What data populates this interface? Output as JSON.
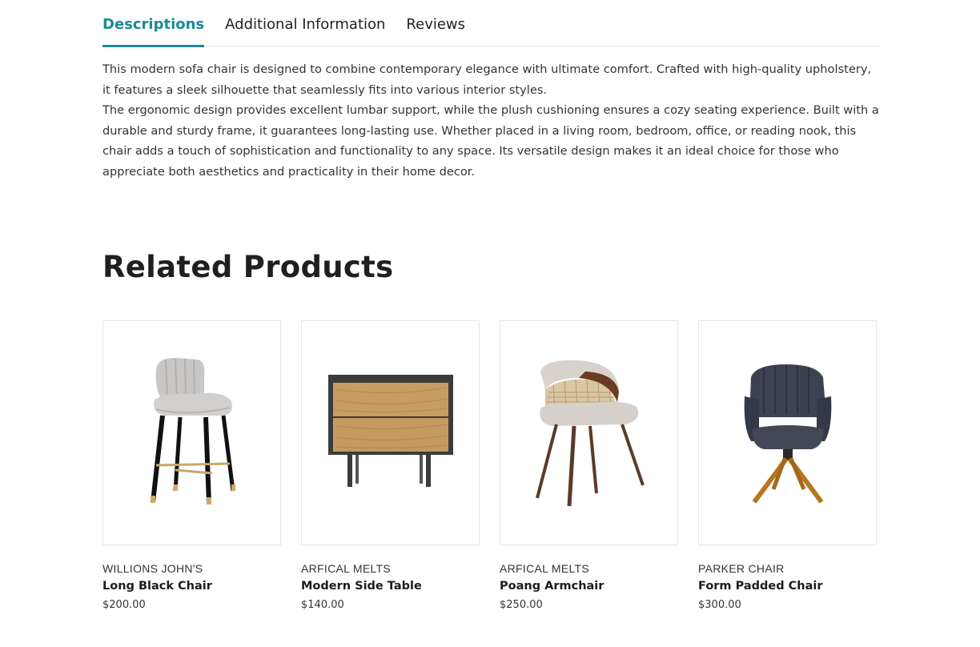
{
  "tabs": [
    {
      "label": "Descriptions",
      "active": true
    },
    {
      "label": "Additional Information",
      "active": false
    },
    {
      "label": "Reviews",
      "active": false
    }
  ],
  "description": {
    "paragraph1": "This modern sofa chair is designed to combine contemporary elegance with ultimate comfort. Crafted with high-quality upholstery, it features a sleek silhouette that seamlessly fits into various interior styles.",
    "paragraph2": "The ergonomic design provides excellent lumbar support, while the plush cushioning ensures a cozy seating experience. Built with a durable and sturdy frame, it guarantees long-lasting use. Whether placed in a living room, bedroom, office, or reading nook, this chair adds a touch of sophistication and functionality to any space. Its versatile design makes it an ideal choice for those who appreciate both aesthetics and practicality in their home decor."
  },
  "related": {
    "title": "Related Products",
    "products": [
      {
        "brand": "WILLIONS JOHN'S",
        "name": "Long Black Chair",
        "price": "$200.00",
        "image": "bar-stool-image"
      },
      {
        "brand": "ARFICAL MELTS",
        "name": "Modern Side Table",
        "price": "$140.00",
        "image": "side-table-image"
      },
      {
        "brand": "ARFICAL MELTS",
        "name": "Poang Armchair",
        "price": "$250.00",
        "image": "armchair-image"
      },
      {
        "brand": "PARKER CHAIR",
        "name": "Form Padded Chair",
        "price": "$300.00",
        "image": "padded-chair-image"
      }
    ]
  },
  "colors": {
    "accent": "#1b8a95",
    "text": "#222222",
    "border": "#e5e5e5"
  }
}
